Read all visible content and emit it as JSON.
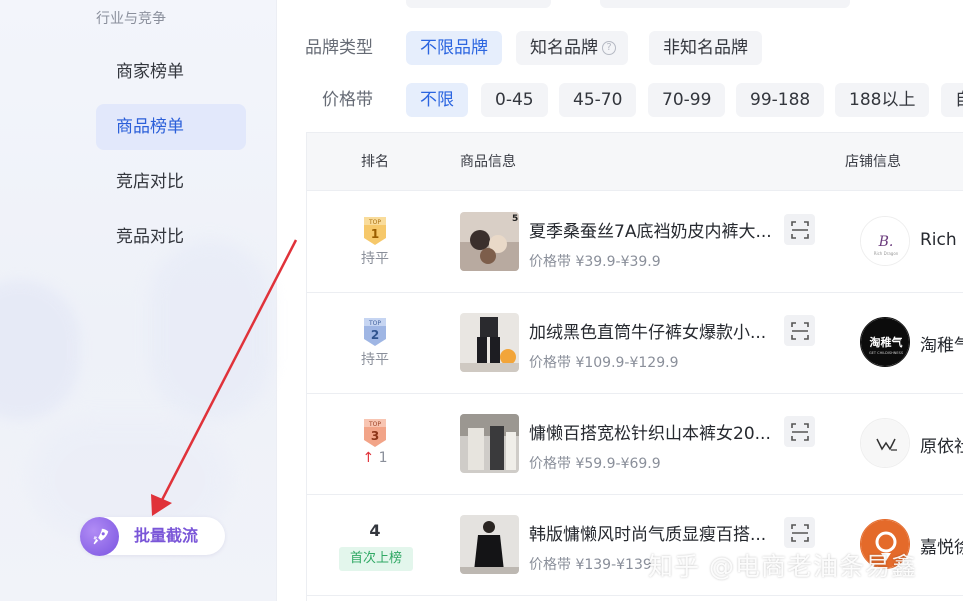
{
  "sidebar": {
    "section_title": "行业与竞争",
    "items": [
      {
        "label": "商家榜单",
        "active": false
      },
      {
        "label": "商品榜单",
        "active": true
      },
      {
        "label": "竞店对比",
        "active": false
      },
      {
        "label": "竞品对比",
        "active": false
      }
    ],
    "flow_button": {
      "label": "批量截流"
    }
  },
  "filters": {
    "brand_type": {
      "label": "品牌类型",
      "options": [
        "不限品牌",
        "知名品牌",
        "非知名品牌"
      ],
      "selected": "不限品牌"
    },
    "price_band": {
      "label": "价格带",
      "options": [
        "不限",
        "0-45",
        "45-70",
        "70-99",
        "99-188",
        "188以上",
        "自"
      ],
      "selected": "不限"
    }
  },
  "table": {
    "columns": {
      "rank": "排名",
      "product": "商品信息",
      "shop": "店铺信息"
    },
    "rows": [
      {
        "rank": "1",
        "change": "持平",
        "title": "夏季桑蚕丝7A底裆奶皮内裤大...",
        "price": "价格带 ¥39.9-¥39.9",
        "shop": "Rich l"
      },
      {
        "rank": "2",
        "change": "持平",
        "title": "加绒黑色直筒牛仔裤女爆款小...",
        "price": "价格带 ¥109.9-¥129.9",
        "shop": "淘稚气"
      },
      {
        "rank": "3",
        "change": "1",
        "title": "慵懒百搭宽松针织山本裤女20...",
        "price": "价格带 ¥59.9-¥69.9",
        "shop": "原依社"
      },
      {
        "rank": "4",
        "change": "首次上榜",
        "title": "韩版慵懒风时尚气质显瘦百搭...",
        "price": "价格带 ¥139-¥139",
        "shop": "嘉悦徐"
      }
    ],
    "badge_top": "TOP",
    "shop_logo_2_text": "淘稚气"
  },
  "watermark": "知乎 @电商老油条易鑫",
  "colors": {
    "accent": "#2b65e0",
    "arrow": "#e0323a",
    "new_badge": "#2fa864"
  }
}
